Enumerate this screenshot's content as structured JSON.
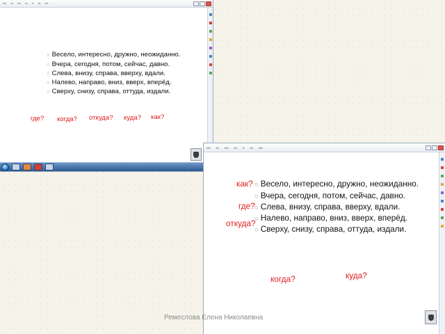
{
  "colors": {
    "question": "#e11b1b",
    "bullet": "#7d93b0",
    "taskbar": "#2d5b96"
  },
  "slide": {
    "lines": [
      "Весело, интересно, дружно, неожиданно.",
      "Вчера, сегодня, потом, сейчас, давно.",
      "Слева, внизу, справа, вверху, вдали.",
      "Налево, направо, вниз, вверх, вперёд.",
      "Сверху, снизу, справа, оттуда, издали."
    ],
    "bullet_char": "○"
  },
  "screen_top": {
    "questions": [
      "где?",
      "когда?",
      "откуда?",
      "куда?",
      "как?"
    ]
  },
  "screen_bottom": {
    "questions": [
      "как?",
      "где?",
      "откуда?",
      "когда?",
      "куда?"
    ]
  },
  "footer": {
    "author": "Ремеслова Елена Николаевна"
  }
}
